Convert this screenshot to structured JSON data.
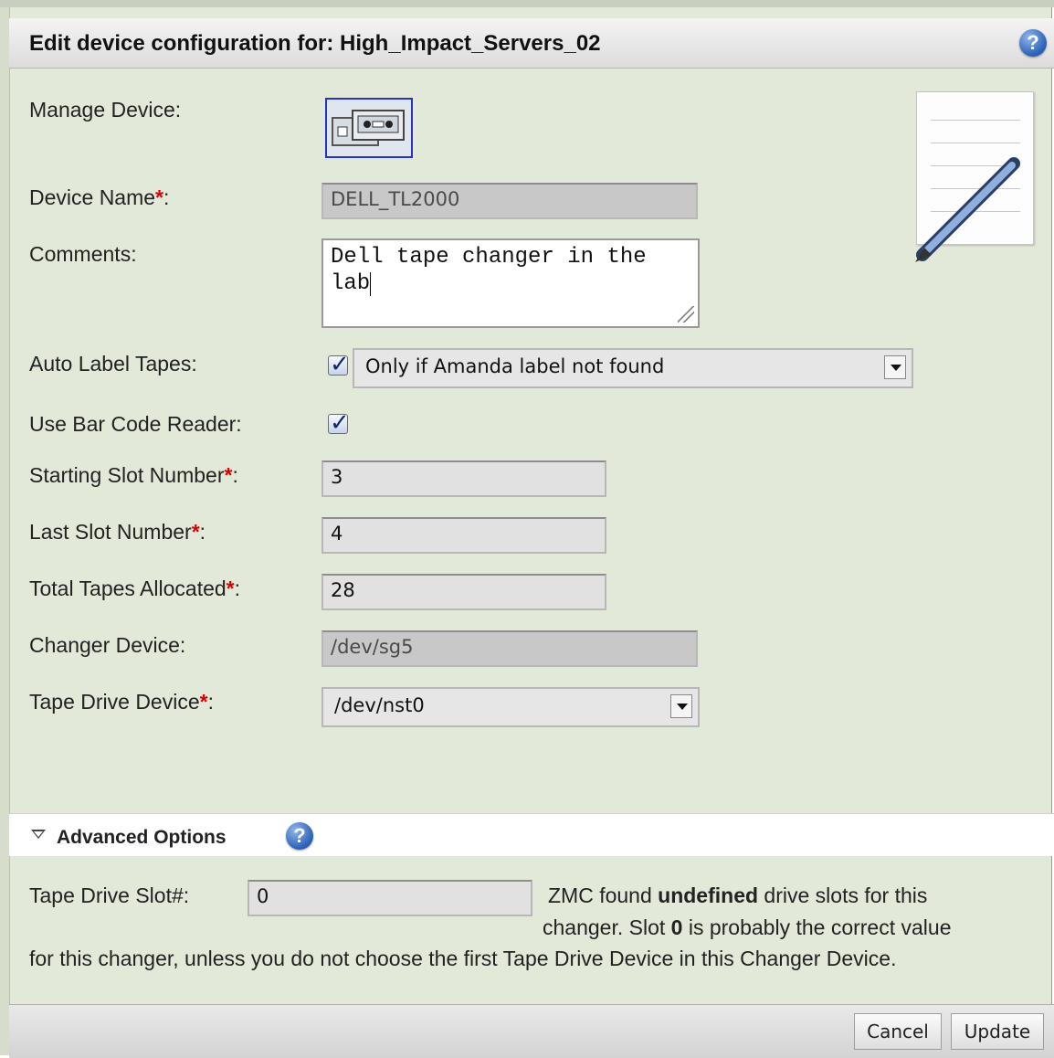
{
  "header": {
    "title": "Edit device configuration for: High_Impact_Servers_02"
  },
  "form": {
    "manage_device_label": "Manage Device:",
    "device_name_label": "Device Name",
    "device_name_value": "DELL_TL2000",
    "comments_label": "Comments:",
    "comments_value": "Dell tape changer in the lab",
    "auto_label_label": "Auto Label Tapes:",
    "auto_label_checked": true,
    "auto_label_option": "Only if Amanda label not found",
    "bar_code_label": "Use Bar Code Reader:",
    "bar_code_checked": true,
    "starting_slot_label": "Starting Slot Number",
    "starting_slot_value": "3",
    "last_slot_label": "Last Slot Number",
    "last_slot_value": "4",
    "total_tapes_label": "Total Tapes Allocated",
    "total_tapes_value": "28",
    "changer_device_label": "Changer Device:",
    "changer_device_value": "/dev/sg5",
    "tape_drive_device_label": "Tape Drive Device",
    "tape_drive_device_value": "/dev/nst0",
    "required_marker": "*",
    "colon": ":"
  },
  "advanced": {
    "title": "Advanced Options",
    "tape_drive_slot_label": "Tape Drive Slot#:",
    "tape_drive_slot_value": "0",
    "note_part1": "ZMC found ",
    "note_bold1": "undefined",
    "note_part2": " drive slots for this",
    "note_line2_a": "changer. Slot ",
    "note_bold2": "0",
    "note_line2_b": " is probably the correct value",
    "note_line3": "for this changer, unless you do not choose the first Tape Drive Device in this Changer Device."
  },
  "footer": {
    "cancel_label": "Cancel",
    "update_label": "Update"
  },
  "colors": {
    "panel_bg": "#e3e9d9",
    "required": "#dd0000",
    "help_icon": "#2a5fb5"
  }
}
